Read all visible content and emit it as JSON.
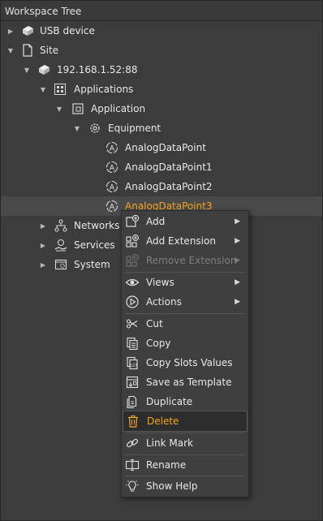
{
  "panel": {
    "title": "Workspace Tree"
  },
  "tree": {
    "usb": "USB device",
    "site": "Site",
    "ip": "192.168.1.52:88",
    "applications": "Applications",
    "application": "Application",
    "equipment": "Equipment",
    "points": [
      "AnalogDataPoint",
      "AnalogDataPoint1",
      "AnalogDataPoint2",
      "AnalogDataPoint3"
    ],
    "networks": "Networks",
    "services": "Services",
    "system": "System"
  },
  "menu": {
    "add": "Add",
    "add_extension": "Add Extension",
    "remove_extension": "Remove Extension",
    "views": "Views",
    "actions": "Actions",
    "cut": "Cut",
    "copy": "Copy",
    "copy_slots": "Copy Slots Values",
    "save_template": "Save as Template",
    "duplicate": "Duplicate",
    "delete": "Delete",
    "link_mark": "Link Mark",
    "rename": "Rename",
    "show_help": "Show Help",
    "submenu_glyph": "▶"
  },
  "colors": {
    "highlight": "#f5a623",
    "background": "#3c3c3c"
  }
}
